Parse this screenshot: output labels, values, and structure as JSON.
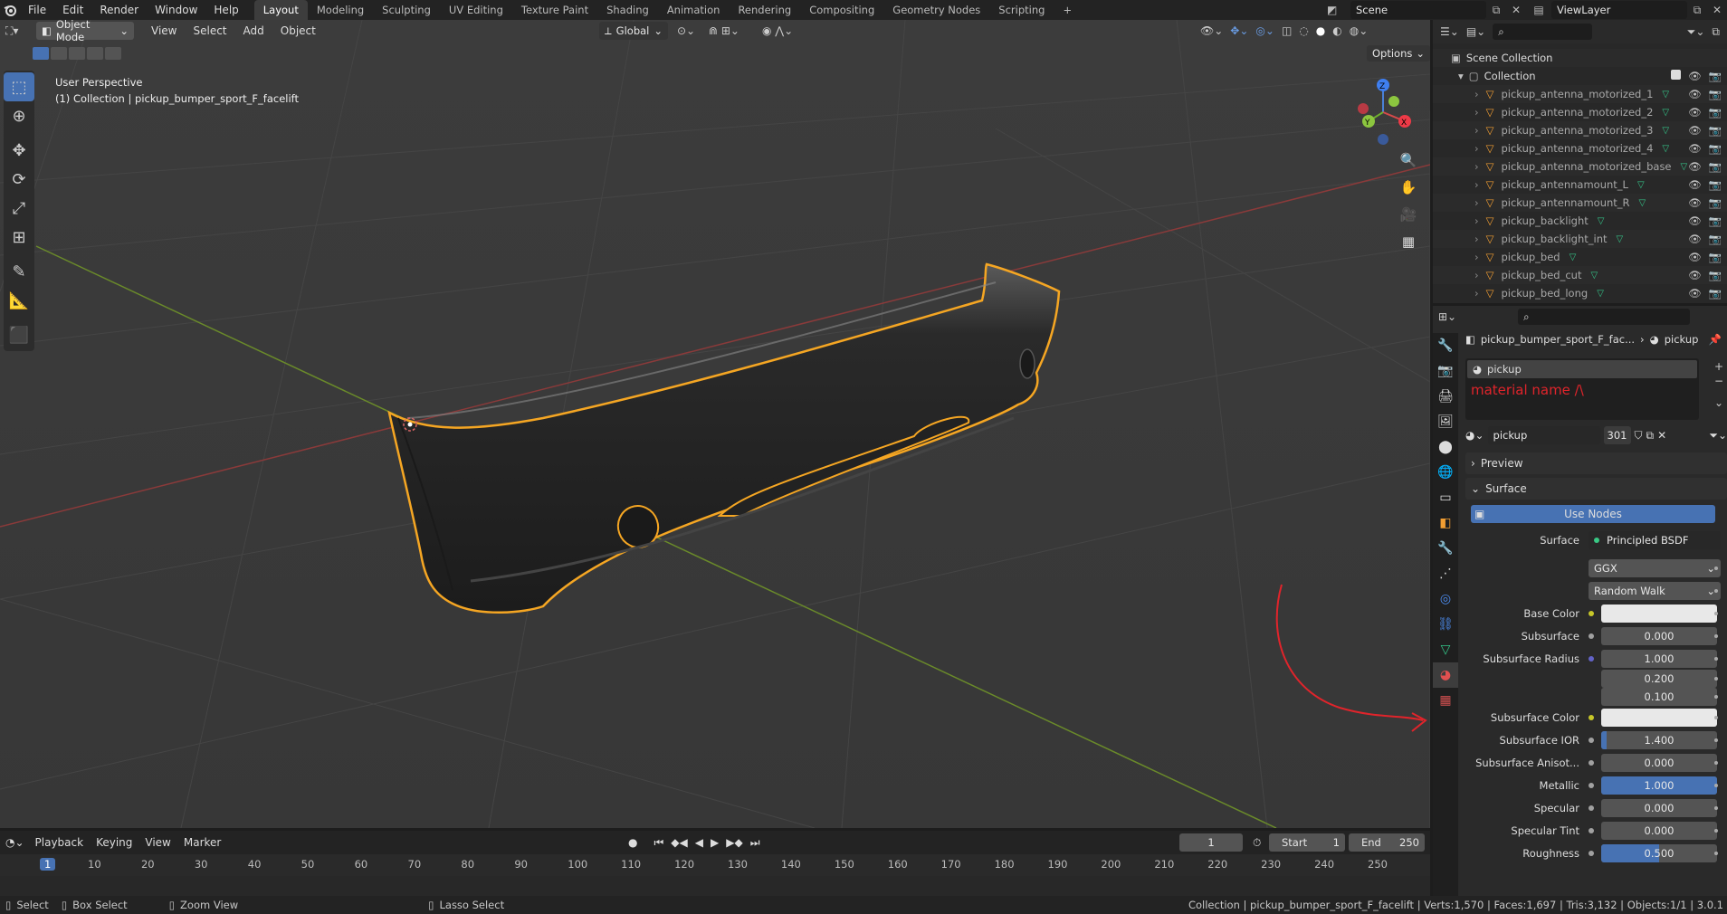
{
  "topbar": {
    "menus": [
      "File",
      "Edit",
      "Render",
      "Window",
      "Help"
    ],
    "workspaces": [
      "Layout",
      "Modeling",
      "Sculpting",
      "UV Editing",
      "Texture Paint",
      "Shading",
      "Animation",
      "Rendering",
      "Compositing",
      "Geometry Nodes",
      "Scripting"
    ],
    "add": "+",
    "scene": "Scene",
    "view_layer": "ViewLayer"
  },
  "viewport": {
    "mode": "Object Mode",
    "menus": [
      "View",
      "Select",
      "Add",
      "Object"
    ],
    "transform": "Global",
    "options": "Options",
    "overlay_title": "User Perspective",
    "overlay_sub": "(1) Collection | pickup_bumper_sport_F_facelift",
    "gizmo": {
      "z": "Z",
      "y": "Y",
      "x": "X"
    }
  },
  "outliner": {
    "scene_collection": "Scene Collection",
    "collection": "Collection",
    "items": [
      "pickup_antenna_motorized_1",
      "pickup_antenna_motorized_2",
      "pickup_antenna_motorized_3",
      "pickup_antenna_motorized_4",
      "pickup_antenna_motorized_base",
      "pickup_antennamount_L",
      "pickup_antennamount_R",
      "pickup_backlight",
      "pickup_backlight_int",
      "pickup_bed",
      "pickup_bed_cut",
      "pickup_bed_long"
    ]
  },
  "properties": {
    "breadcrumb_object": "pickup_bumper_sport_F_fac...",
    "breadcrumb_material": "pickup",
    "slot": "pickup",
    "annotation": "material name /\\",
    "material": "pickup",
    "users": "301",
    "preview": "Preview",
    "surface_panel": "Surface",
    "use_nodes": "Use Nodes",
    "surface_label": "Surface",
    "surface_value": "Principled BSDF",
    "distribution": "GGX",
    "subsurface_method": "Random Walk",
    "fields": [
      {
        "label": "Base Color",
        "value": "",
        "type": "color",
        "socket": "#c7c729"
      },
      {
        "label": "Subsurface",
        "value": "0.000",
        "type": "num",
        "socket": "#a1a1a1"
      },
      {
        "label": "Subsurface Radius",
        "value": "1.000",
        "type": "num",
        "socket": "#6363c7"
      },
      {
        "label": "",
        "value": "0.200",
        "type": "num"
      },
      {
        "label": "",
        "value": "0.100",
        "type": "num"
      },
      {
        "label": "Subsurface Color",
        "value": "",
        "type": "color",
        "socket": "#c7c729"
      },
      {
        "label": "Subsurface IOR",
        "value": "1.400",
        "type": "slider",
        "fill": 0.05,
        "socket": "#a1a1a1"
      },
      {
        "label": "Subsurface Anisot...",
        "value": "0.000",
        "type": "num",
        "socket": "#a1a1a1"
      },
      {
        "label": "Metallic",
        "value": "1.000",
        "type": "slider",
        "fill": 1.0,
        "socket": "#a1a1a1"
      },
      {
        "label": "Specular",
        "value": "0.000",
        "type": "num",
        "socket": "#a1a1a1"
      },
      {
        "label": "Specular Tint",
        "value": "0.000",
        "type": "num",
        "socket": "#a1a1a1"
      },
      {
        "label": "Roughness",
        "value": "0.500",
        "type": "slider",
        "fill": 0.5,
        "socket": "#a1a1a1"
      }
    ]
  },
  "timeline": {
    "menus": [
      "Playback",
      "Keying",
      "View",
      "Marker"
    ],
    "current_frame": "1",
    "start_label": "Start",
    "start": "1",
    "end_label": "End",
    "end": "250",
    "ticks": [
      "1",
      "10",
      "20",
      "30",
      "40",
      "50",
      "60",
      "70",
      "80",
      "90",
      "100",
      "110",
      "120",
      "130",
      "140",
      "150",
      "160",
      "170",
      "180",
      "190",
      "200",
      "210",
      "220",
      "230",
      "240",
      "250"
    ]
  },
  "status": {
    "select": "Select",
    "box_select": "Box Select",
    "zoom_view": "Zoom View",
    "lasso_select": "Lasso Select",
    "info": "Collection | pickup_bumper_sport_F_facelift | Verts:1,570 | Faces:1,697 | Tris:3,132 | Objects:1/1 | 3.0.1"
  },
  "colors": {
    "accent": "#4772b3",
    "outline": "#f5a623",
    "annotation": "#e0242b"
  }
}
